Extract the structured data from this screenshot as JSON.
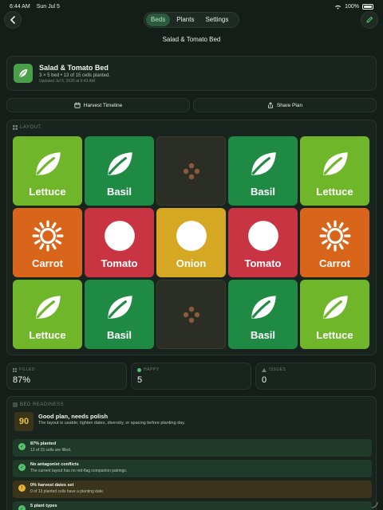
{
  "status": {
    "time": "6:44 AM",
    "date": "Sun Jul 5",
    "battery": "100%"
  },
  "tabs": [
    {
      "label": "Beds",
      "active": true
    },
    {
      "label": "Plants",
      "active": false
    },
    {
      "label": "Settings",
      "active": false
    }
  ],
  "nav": {
    "title": "Salad & Tomato Bed"
  },
  "bed": {
    "name": "Salad & Tomato Bed",
    "summary": "3 × 5 bed • 13 of 15 cells planted.",
    "updated": "Updated Jul 5, 2026 at 6:43 AM"
  },
  "actions": {
    "harvest_timeline": "Harvest Timeline",
    "share_plan": "Share Plan"
  },
  "layout": {
    "header": "LAYOUT",
    "cells": [
      {
        "plant": "Lettuce",
        "icon": "leaf-icon",
        "color": "#6fb62a"
      },
      {
        "plant": "Basil",
        "icon": "leaf-icon",
        "color": "#1f8a44"
      },
      {
        "plant": "",
        "icon": "empty-cell-icon",
        "color": "#2b2e25"
      },
      {
        "plant": "Basil",
        "icon": "leaf-icon",
        "color": "#1f8a44"
      },
      {
        "plant": "Lettuce",
        "icon": "leaf-icon",
        "color": "#6fb62a"
      },
      {
        "plant": "Carrot",
        "icon": "carrot-icon",
        "color": "#d9651a"
      },
      {
        "plant": "Tomato",
        "icon": "circle-icon",
        "color": "#c93443"
      },
      {
        "plant": "Onion",
        "icon": "circle-icon",
        "color": "#d6a722"
      },
      {
        "plant": "Tomato",
        "icon": "circle-icon",
        "color": "#c93443"
      },
      {
        "plant": "Carrot",
        "icon": "carrot-icon",
        "color": "#d9651a"
      },
      {
        "plant": "Lettuce",
        "icon": "leaf-icon",
        "color": "#6fb62a"
      },
      {
        "plant": "Basil",
        "icon": "leaf-icon",
        "color": "#1f8a44"
      },
      {
        "plant": "",
        "icon": "empty-cell-icon",
        "color": "#2b2e25"
      },
      {
        "plant": "Basil",
        "icon": "leaf-icon",
        "color": "#1f8a44"
      },
      {
        "plant": "Lettuce",
        "icon": "leaf-icon",
        "color": "#6fb62a"
      }
    ]
  },
  "stats": {
    "filled": {
      "label": "FILLED",
      "value": "87%"
    },
    "happy": {
      "label": "HAPPY",
      "value": "5"
    },
    "issues": {
      "label": "ISSUES",
      "value": "0"
    }
  },
  "readiness": {
    "header": "BED READINESS",
    "score": "90",
    "title": "Good plan, needs polish",
    "subtitle": "The layout is usable; tighten dates, diversity, or spacing before planting day.",
    "checks": [
      {
        "title": "87% planted",
        "sub": "13 of 15 cells are filled.",
        "state": "ok"
      },
      {
        "title": "No antagonist conflicts",
        "sub": "The current layout has no red-flag companion pairings.",
        "state": "ok"
      },
      {
        "title": "0% harvest dates set",
        "sub": "0 of 13 planted cells have a planting date.",
        "state": "warn"
      },
      {
        "title": "5 plant types",
        "sub": "",
        "state": "ok"
      }
    ]
  },
  "colors": {
    "accent": "#56c46c",
    "warning": "#e8b634",
    "background": "#141d18"
  }
}
